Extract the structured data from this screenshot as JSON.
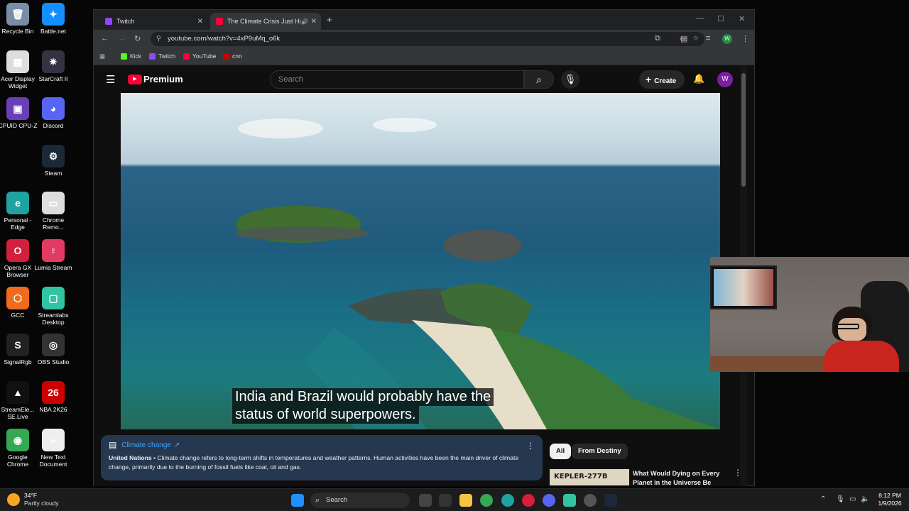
{
  "desktop": {
    "icons": [
      {
        "label": "Recycle Bin",
        "color": "#7a8da8",
        "glyph": "🗑"
      },
      {
        "label": "Battle.net",
        "color": "#148eff",
        "glyph": "✦"
      },
      {
        "label": "Acer Display Widget",
        "color": "#ddd",
        "glyph": "▦"
      },
      {
        "label": "StarCraft II",
        "color": "#334",
        "glyph": "✷"
      },
      {
        "label": "CPUID CPU-Z",
        "color": "#6a3fb5",
        "glyph": "▣"
      },
      {
        "label": "Discord",
        "color": "#5865f2",
        "glyph": "◕"
      },
      {
        "label": "Steam",
        "color": "#1b2838",
        "glyph": "⚙"
      },
      {
        "label": "Personal - Edge",
        "color": "#1fa3a0",
        "glyph": "e"
      },
      {
        "label": "Chrome Remo...",
        "color": "#ddd",
        "glyph": "▭"
      },
      {
        "label": "Opera GX Browser",
        "color": "#d31f3c",
        "glyph": "O"
      },
      {
        "label": "Lumia Stream",
        "color": "#e23a63",
        "glyph": "♀"
      },
      {
        "label": "GCC",
        "color": "#f06b1d",
        "glyph": "⬡"
      },
      {
        "label": "Streamlabs Desktop",
        "color": "#31c3a2",
        "glyph": "▢"
      },
      {
        "label": "SignalRgb",
        "color": "#222",
        "glyph": "S"
      },
      {
        "label": "OBS Studio",
        "color": "#333",
        "glyph": "◎"
      },
      {
        "label": "StreamEle... SE.Live",
        "color": "#111",
        "glyph": "▲"
      },
      {
        "label": "NBA 2K26",
        "color": "#c00",
        "glyph": "26"
      },
      {
        "label": "Google Chrome",
        "color": "#34a853",
        "glyph": "◉"
      },
      {
        "label": "New Text Document",
        "color": "#eee",
        "glyph": "≡"
      }
    ]
  },
  "browser": {
    "tabs": [
      {
        "title": "Twitch",
        "color": "#9146ff"
      },
      {
        "title": "The Climate Crisis Just Hit a",
        "color": "#ff0033"
      }
    ],
    "url": "youtube.com/watch?v=4xP9uMq_o6k",
    "profile_initial": "W",
    "bookmarks": [
      {
        "label": "Kick",
        "color": "#53fc18"
      },
      {
        "label": "Twitch",
        "color": "#9146ff"
      },
      {
        "label": "YouTube",
        "color": "#ff0033"
      },
      {
        "label": "cnn",
        "color": "#cc0000"
      }
    ]
  },
  "youtube": {
    "logo": "Premium",
    "search_placeholder": "Search",
    "create_label": "Create",
    "avatar_initial": "W",
    "caption_line1": "India and Brazil would probably have the",
    "caption_line2": "status of world superpowers.",
    "info_panel": {
      "title": "Climate change",
      "source": "United Nations",
      "text": "• Climate change refers to long-term shifts in temperatures and weather patterns. Human activities have been the main driver of climate change, primarily due to the burning of fossil fuels like coal, oil and gas."
    },
    "chips": [
      "All",
      "From Destiny"
    ],
    "recommendation": {
      "title": "What Would Dying on Every Planet in the Universe Be Like?",
      "thumb_text": "KEPLER-277B"
    }
  },
  "taskbar": {
    "weather_temp": "34°F",
    "weather_desc": "Partly cloudy",
    "search_label": "Search",
    "time": "8:12 PM",
    "date": "1/9/2026"
  }
}
